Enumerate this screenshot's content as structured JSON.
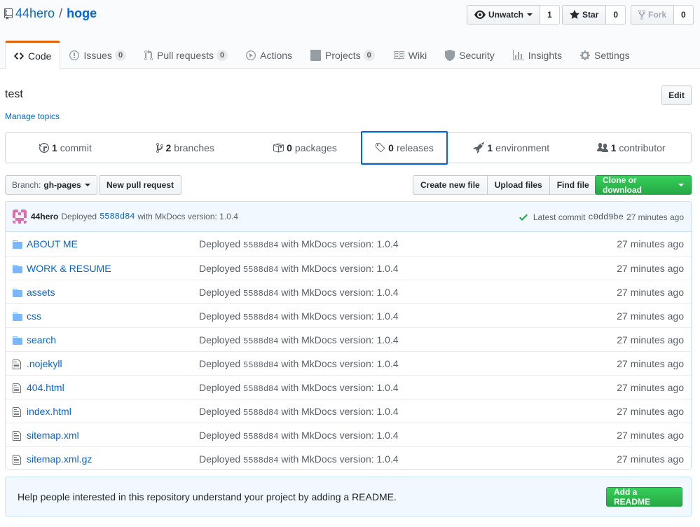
{
  "repo": {
    "owner": "44hero",
    "separator": "/",
    "name": "hoge"
  },
  "actions": {
    "watch": {
      "label": "Unwatch",
      "count": "1"
    },
    "star": {
      "label": "Star",
      "count": "0"
    },
    "fork": {
      "label": "Fork",
      "count": "0"
    }
  },
  "tabs": [
    {
      "label": "Code"
    },
    {
      "label": "Issues",
      "count": "0"
    },
    {
      "label": "Pull requests",
      "count": "0"
    },
    {
      "label": "Actions"
    },
    {
      "label": "Projects",
      "count": "0"
    },
    {
      "label": "Wiki"
    },
    {
      "label": "Security"
    },
    {
      "label": "Insights"
    },
    {
      "label": "Settings"
    }
  ],
  "description": "test",
  "manage_topics": "Manage topics",
  "edit_label": "Edit",
  "summary": [
    {
      "num": "1",
      "label": "commit"
    },
    {
      "num": "2",
      "label": "branches"
    },
    {
      "num": "0",
      "label": "packages"
    },
    {
      "num": "0",
      "label": "releases"
    },
    {
      "num": "1",
      "label": "environment"
    },
    {
      "num": "1",
      "label": "contributor"
    }
  ],
  "branch": {
    "label": "Branch:",
    "value": "gh-pages"
  },
  "new_pr": "New pull request",
  "file_actions": [
    "Create new file",
    "Upload files",
    "Find file"
  ],
  "clone": "Clone or download",
  "latest_commit": {
    "author": "44hero",
    "verb": "Deployed",
    "sha": "5588d84",
    "message": "with MkDocs version: 1.0.4",
    "latest_label": "Latest commit",
    "latest_sha": "c0dd9be",
    "age": "27 minutes ago"
  },
  "files": [
    {
      "type": "dir",
      "name": "ABOUT ME",
      "msg_pre": "Deployed",
      "sha": "5588d84",
      "msg_post": "with MkDocs version: 1.0.4",
      "age": "27 minutes ago"
    },
    {
      "type": "dir",
      "name": "WORK & RESUME",
      "msg_pre": "Deployed",
      "sha": "5588d84",
      "msg_post": "with MkDocs version: 1.0.4",
      "age": "27 minutes ago"
    },
    {
      "type": "dir",
      "name": "assets",
      "msg_pre": "Deployed",
      "sha": "5588d84",
      "msg_post": "with MkDocs version: 1.0.4",
      "age": "27 minutes ago"
    },
    {
      "type": "dir",
      "name": "css",
      "msg_pre": "Deployed",
      "sha": "5588d84",
      "msg_post": "with MkDocs version: 1.0.4",
      "age": "27 minutes ago"
    },
    {
      "type": "dir",
      "name": "search",
      "msg_pre": "Deployed",
      "sha": "5588d84",
      "msg_post": "with MkDocs version: 1.0.4",
      "age": "27 minutes ago"
    },
    {
      "type": "file",
      "name": ".nojekyll",
      "msg_pre": "Deployed",
      "sha": "5588d84",
      "msg_post": "with MkDocs version: 1.0.4",
      "age": "27 minutes ago"
    },
    {
      "type": "file",
      "name": "404.html",
      "msg_pre": "Deployed",
      "sha": "5588d84",
      "msg_post": "with MkDocs version: 1.0.4",
      "age": "27 minutes ago"
    },
    {
      "type": "file",
      "name": "index.html",
      "msg_pre": "Deployed",
      "sha": "5588d84",
      "msg_post": "with MkDocs version: 1.0.4",
      "age": "27 minutes ago"
    },
    {
      "type": "file",
      "name": "sitemap.xml",
      "msg_pre": "Deployed",
      "sha": "5588d84",
      "msg_post": "with MkDocs version: 1.0.4",
      "age": "27 minutes ago"
    },
    {
      "type": "file",
      "name": "sitemap.xml.gz",
      "msg_pre": "Deployed",
      "sha": "5588d84",
      "msg_post": "with MkDocs version: 1.0.4",
      "age": "27 minutes ago"
    }
  ],
  "readme": {
    "text": "Help people interested in this repository understand your project by adding a README.",
    "button": "Add a README"
  },
  "colors": {
    "accent": "#0366d6",
    "green": "#28a745",
    "tab_orange": "#e36209"
  }
}
